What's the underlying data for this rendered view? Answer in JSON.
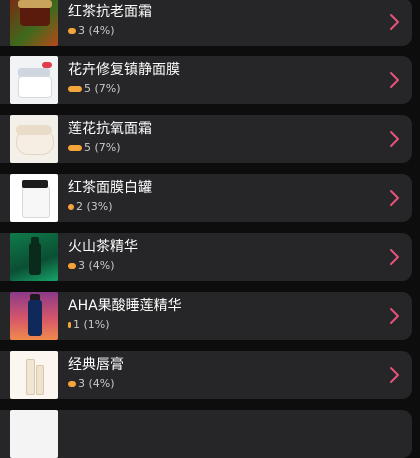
{
  "products": [
    {
      "name": "红茶抗老面霜",
      "stat": "3 (4%)",
      "fraction": 0.04
    },
    {
      "name": "花卉修复镇静面膜",
      "stat": "5 (7%)",
      "fraction": 0.07
    },
    {
      "name": "莲花抗氧面霜",
      "stat": "5 (7%)",
      "fraction": 0.07
    },
    {
      "name": "红茶面膜白罐",
      "stat": "2 (3%)",
      "fraction": 0.03
    },
    {
      "name": "火山茶精华",
      "stat": "3 (4%)",
      "fraction": 0.04
    },
    {
      "name": "AHA果酸睡莲精华",
      "stat": "1 (1%)",
      "fraction": 0.01
    },
    {
      "name": "经典唇膏",
      "stat": "3 (4%)",
      "fraction": 0.04
    }
  ],
  "colors": {
    "background": "#0d0d0d",
    "row": "#262628",
    "bar": "#f4a53a",
    "chevron": "#e5537a"
  },
  "icons": {
    "chevron": "chevron-right-icon"
  }
}
